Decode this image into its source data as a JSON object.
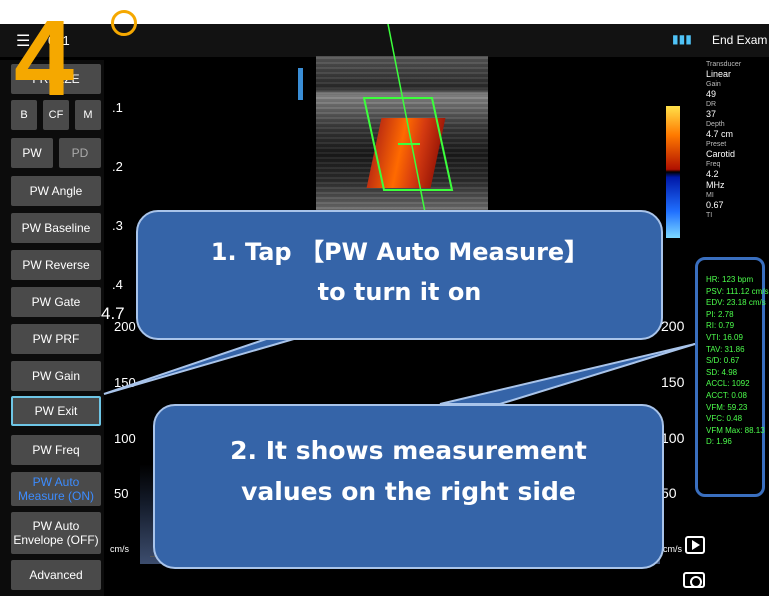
{
  "step": {
    "number": "4"
  },
  "topbar": {
    "menu_icon": "hamburger-menu-icon",
    "patient_id": "001",
    "end_exam_label": "End Exam"
  },
  "sidebar": {
    "freeze": "FREEZE",
    "mode_b": "B",
    "mode_cf": "CF",
    "mode_m": "M",
    "pw": "PW",
    "pd": "PD",
    "pw_angle": "PW Angle",
    "pw_baseline": "PW Baseline",
    "pw_reverse": "PW Reverse",
    "pw_gate": "PW Gate",
    "pw_prf": "PW PRF",
    "pw_gain": "PW Gain",
    "pw_exit": "PW Exit",
    "pw_freq": "PW Freq",
    "pw_auto_measure": "PW Auto Measure (ON)",
    "pw_auto_envelope": "PW Auto Envelope (OFF)",
    "advanced": "Advanced"
  },
  "image": {
    "depth_ticks": [
      ".1",
      ".2",
      ".3",
      ".4"
    ],
    "depth_value": "4.7"
  },
  "params": {
    "transducer_label": "Transducer",
    "transducer": "Linear",
    "gain_label": "Gain",
    "gain": "49",
    "dr_label": "DR",
    "dr": "37",
    "depth_label": "Depth",
    "depth": "4.7 cm",
    "preset_label": "Preset",
    "preset": "Carotid",
    "freq_label": "Freq",
    "freq": "4.2",
    "freq_unit": "MHz",
    "mi_label": "MI",
    "mi": "0.67",
    "ti_label": "TI"
  },
  "measurements": [
    "HR: 123 bpm",
    "PSV: 111.12 cm/s",
    "EDV: 23.18 cm/s",
    "PI: 2.78",
    "RI: 0.79",
    "VTI: 16.09",
    "TAV: 31.86",
    "S/D: 0.67",
    "SD: 4.98",
    "ACCL: 1092",
    "ACCT: 0.08",
    "VFM: 59.23",
    "VFC: 0.48",
    "VFM Max: 88.13",
    "D: 1.96"
  ],
  "scale": {
    "left": [
      "200",
      "150",
      "100",
      "50"
    ],
    "right": [
      "200",
      "150",
      "100",
      "50"
    ],
    "unit_left": "cm/s",
    "unit_right": "cm/s"
  },
  "callouts": {
    "first_line1": "1. Tap 【PW Auto Measure】",
    "first_line2": "to turn it on",
    "second_line1": "2. It shows measurement",
    "second_line2": "values on the right side"
  },
  "colors": {
    "accent_orange": "#f5a800",
    "callout_blue": "#3564a8",
    "measurement_green": "#4cff4c",
    "highlight_blue": "#3a6fbf"
  }
}
